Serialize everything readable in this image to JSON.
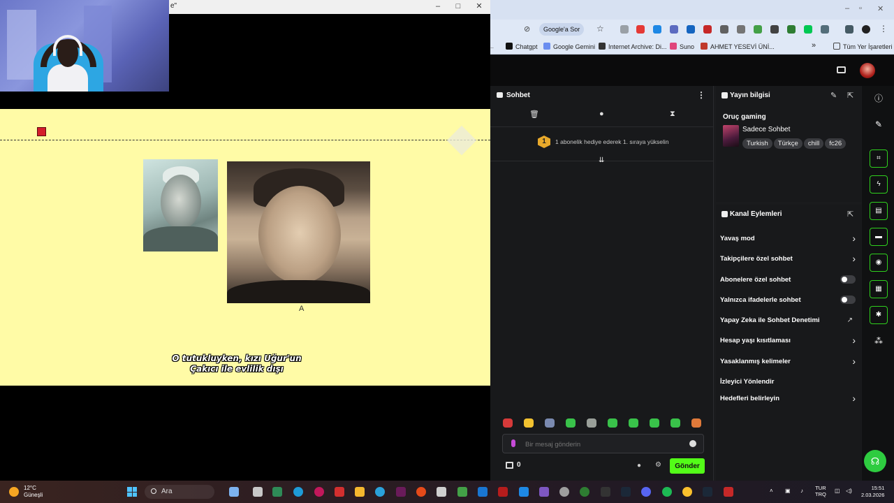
{
  "video": {
    "window_title": "e\"",
    "slide": {
      "photo_caption": "A",
      "subtitle_line1": "O tutukluyken, kızı Uğur'un",
      "subtitle_line2": "Çakıcı ile evlilik dışı"
    }
  },
  "browser": {
    "toolbar": {
      "google_sor": "Google'a Sor"
    },
    "bookmarks": [
      {
        "label": "Chatgpt",
        "color": "#111111"
      },
      {
        "label": "Google Gemini",
        "color": "#6a8df0"
      },
      {
        "label": "Internet Archive: Di...",
        "color": "#333333"
      },
      {
        "label": "Suno",
        "color": "#e0457b"
      },
      {
        "label": "AHMET YESEVİ ÜNİ...",
        "color": "#c0392b"
      }
    ],
    "bookmarks_overflow": "»",
    "all_bookmarks": "Tüm Yer İşaretleri"
  },
  "chat": {
    "title": "Sohbet",
    "banner_badge": "1",
    "banner_text": "1 abonelik hediye ederek 1. sıraya yükselin",
    "input_placeholder": "Bir mesaj gönderin",
    "gift_count": "0",
    "send_label": "Gönder",
    "emote_colors": [
      "#d63a3a",
      "#f2c230",
      "#7a8ab0",
      "#39c24a",
      "#9aa09a",
      "#39c24a",
      "#39c24a",
      "#39c24a",
      "#39c24a",
      "#e07a3a"
    ]
  },
  "stream_info": {
    "title": "Yayın bilgisi",
    "channel_name": "Oruç gaming",
    "stream_title": "Sadece Sohbet",
    "tags": [
      "Turkish",
      "Türkçe",
      "chill",
      "fc26"
    ]
  },
  "channel_actions": {
    "title": "Kanal Eylemleri",
    "rows": [
      {
        "label": "Yavaş mod",
        "control": "chevron"
      },
      {
        "label": "Takipçilere özel sohbet",
        "control": "chevron"
      },
      {
        "label": "Abonelere özel sohbet",
        "control": "toggle",
        "on": false
      },
      {
        "label": "Yalnızca ifadelerle sohbet",
        "control": "toggle",
        "on": false
      },
      {
        "label": "Yapay Zeka ile Sohbet Denetimi",
        "control": "external"
      },
      {
        "label": "Hesap yaşı kısıtlaması",
        "control": "chevron"
      },
      {
        "label": "Yasaklanmış kelimeler",
        "control": "chevron"
      },
      {
        "label": "İzleyici Yönlendir",
        "control": "none"
      },
      {
        "label": "Hedefleri belirleyin",
        "control": "chevron"
      }
    ]
  },
  "taskbar": {
    "temperature": "12°C",
    "weather": "Güneşli",
    "search_label": "Ara",
    "lang_line1": "TUR",
    "lang_line2": "TRQ",
    "time": "15:51",
    "date": "2.03.2026"
  },
  "colors": {
    "kick_green": "#53fc18",
    "slide_bg": "#fffba6",
    "panel_bg": "#18191b"
  }
}
